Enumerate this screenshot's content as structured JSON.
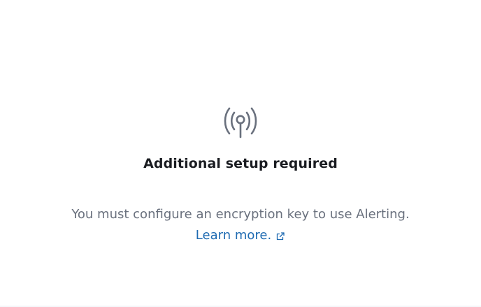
{
  "empty_state": {
    "icon": "broadcast-antenna-icon",
    "title": "Additional setup required",
    "message": "You must configure an encryption key to use Alerting.",
    "link_label": "Learn more.",
    "link_icon": "external-link-icon"
  },
  "colors": {
    "title": "#1a1c21",
    "body": "#69707d",
    "link": "#1f6bb2",
    "icon": "#69707d"
  }
}
